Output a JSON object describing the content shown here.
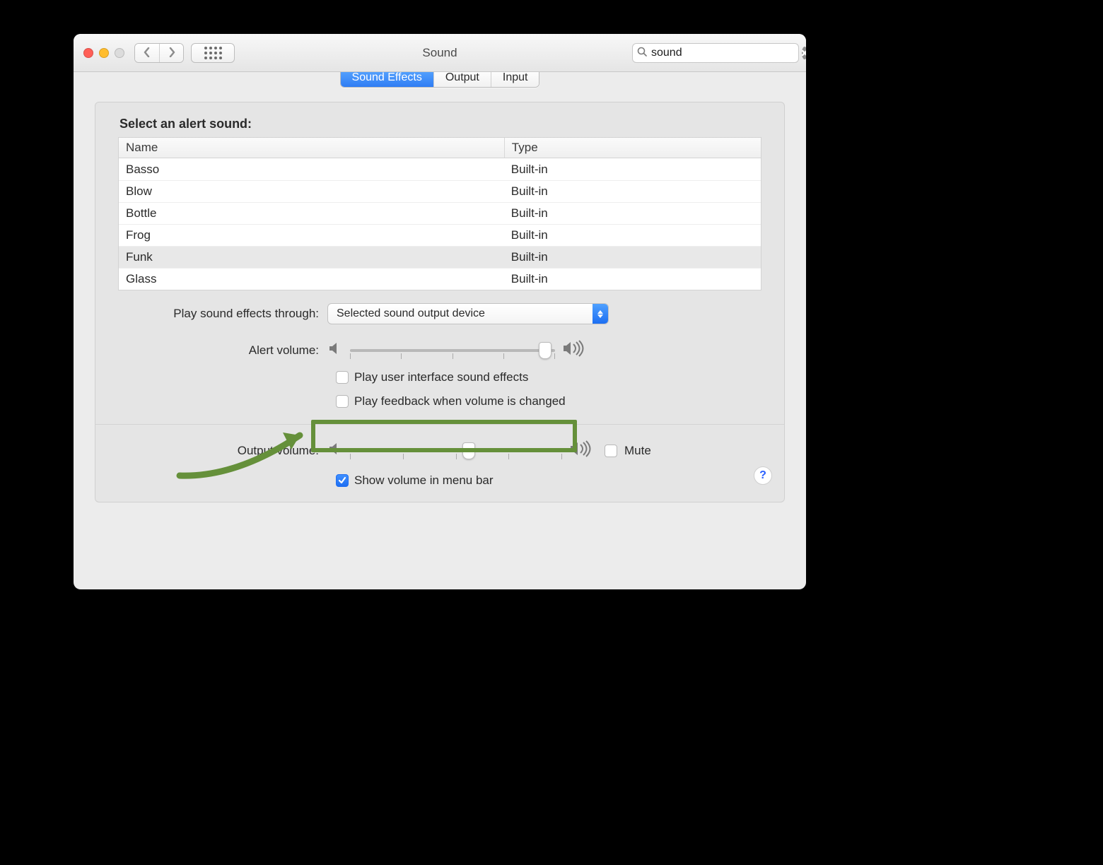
{
  "window": {
    "title": "Sound"
  },
  "search": {
    "placeholder": "Search",
    "value": "sound"
  },
  "tabs": {
    "sound_effects": "Sound Effects",
    "output": "Output",
    "input": "Input",
    "active": "sound_effects"
  },
  "section": {
    "select_alert": "Select an alert sound:"
  },
  "table": {
    "columns": {
      "name": "Name",
      "type": "Type"
    },
    "rows": [
      {
        "name": "Basso",
        "type": "Built-in"
      },
      {
        "name": "Blow",
        "type": "Built-in"
      },
      {
        "name": "Bottle",
        "type": "Built-in"
      },
      {
        "name": "Frog",
        "type": "Built-in"
      },
      {
        "name": "Funk",
        "type": "Built-in"
      },
      {
        "name": "Glass",
        "type": "Built-in"
      }
    ],
    "selected_index": 4
  },
  "effects_device": {
    "label": "Play sound effects through:",
    "value": "Selected sound output device"
  },
  "alert_volume": {
    "label": "Alert volume:",
    "percent": 95
  },
  "checkboxes": {
    "ui_effects": {
      "label": "Play user interface sound effects",
      "checked": false
    },
    "volume_feedback": {
      "label": "Play feedback when volume is changed",
      "checked": false
    },
    "show_menu": {
      "label": "Show volume in menu bar",
      "checked": true
    },
    "mute": {
      "label": "Mute",
      "checked": false
    }
  },
  "output_volume": {
    "label": "Output volume:",
    "percent": 56
  },
  "help": "?",
  "colors": {
    "annotation": "#65903a"
  }
}
